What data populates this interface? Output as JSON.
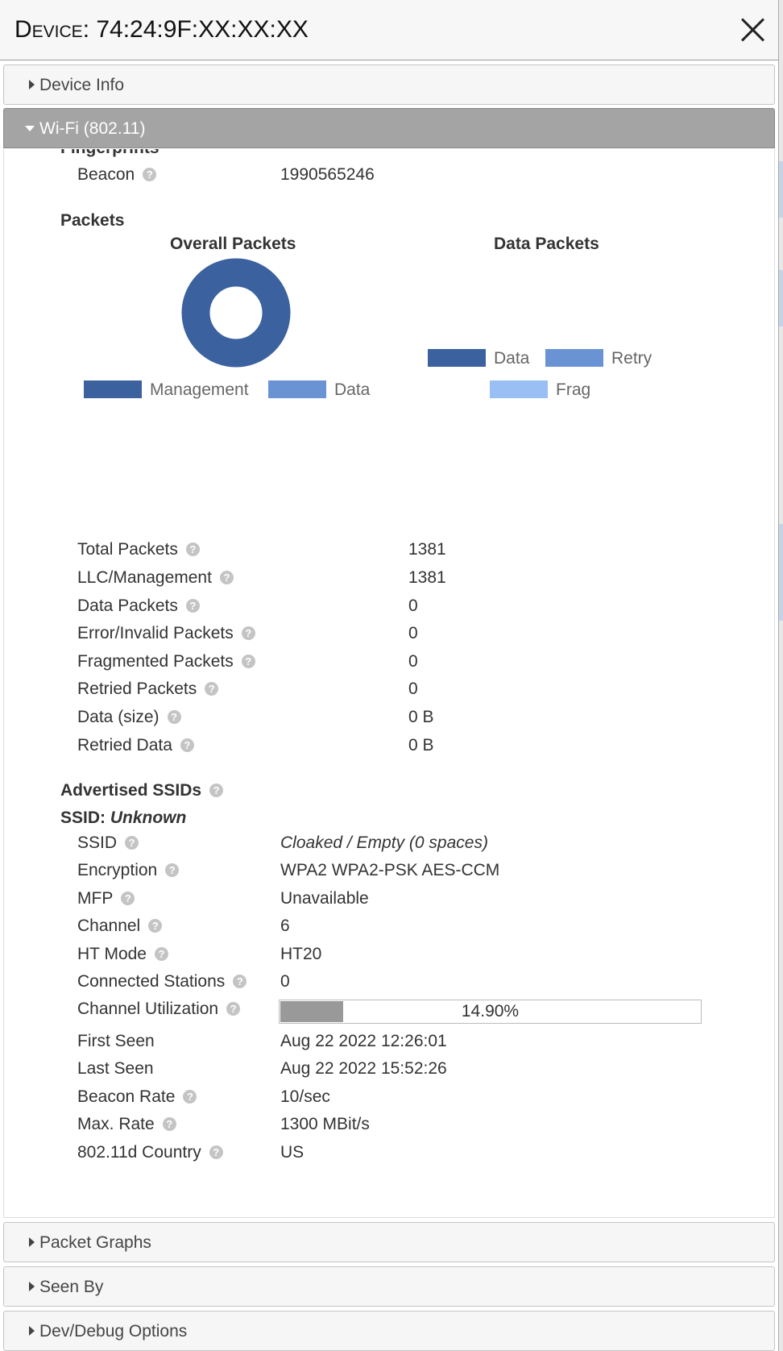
{
  "window": {
    "title_prefix": "Device",
    "title_suffix": ": 74:24:9F:XX:XX:XX"
  },
  "accordion": {
    "device_info": "Device Info",
    "wifi": "Wi-Fi (802.11)",
    "packet_graphs": "Packet Graphs",
    "seen_by": "Seen By",
    "dev_debug": "Dev/Debug Options"
  },
  "fingerprints": {
    "heading": "Fingerprints",
    "beacon_label": "Beacon",
    "beacon_value": "1990565246"
  },
  "packets": {
    "heading": "Packets",
    "overall_title": "Overall Packets",
    "data_title": "Data Packets",
    "overall_legend": [
      "Management",
      "Data"
    ],
    "data_legend": [
      "Data",
      "Retry",
      "Frag"
    ],
    "colors": {
      "management": "#3b619f",
      "data": "#6a93d3",
      "retry": "#6a93d3",
      "frag": "#9abff5"
    },
    "stats": [
      {
        "label": "Total Packets",
        "value": "1381"
      },
      {
        "label": "LLC/Management",
        "value": "1381"
      },
      {
        "label": "Data Packets",
        "value": "0"
      },
      {
        "label": "Error/Invalid Packets",
        "value": "0"
      },
      {
        "label": "Fragmented Packets",
        "value": "0"
      },
      {
        "label": "Retried Packets",
        "value": "0"
      },
      {
        "label": "Data (size)",
        "value": "0 B"
      },
      {
        "label": "Retried Data",
        "value": "0 B"
      }
    ]
  },
  "ssids": {
    "heading": "Advertised SSIDs",
    "ssid_prefix": "SSID: ",
    "ssid_name": "Unknown",
    "rows": [
      {
        "label": "SSID",
        "value": "Cloaked / Empty (0 spaces)"
      },
      {
        "label": "Encryption",
        "value": "WPA2 WPA2-PSK AES-CCM"
      },
      {
        "label": "MFP",
        "value": "Unavailable"
      },
      {
        "label": "Channel",
        "value": "6"
      },
      {
        "label": "HT Mode",
        "value": "HT20"
      },
      {
        "label": "Connected Stations",
        "value": "0"
      },
      {
        "label": "Channel Utilization",
        "value": "14.90%"
      },
      {
        "label": "First Seen",
        "value": "Aug 22 2022 12:26:01"
      },
      {
        "label": "Last Seen",
        "value": "Aug 22 2022 15:52:26"
      },
      {
        "label": "Beacon Rate",
        "value": "10/sec"
      },
      {
        "label": "Max. Rate",
        "value": "1300 MBit/s"
      },
      {
        "label": "802.11d Country",
        "value": "US"
      }
    ],
    "channel_utilization_pct": 14.9
  }
}
